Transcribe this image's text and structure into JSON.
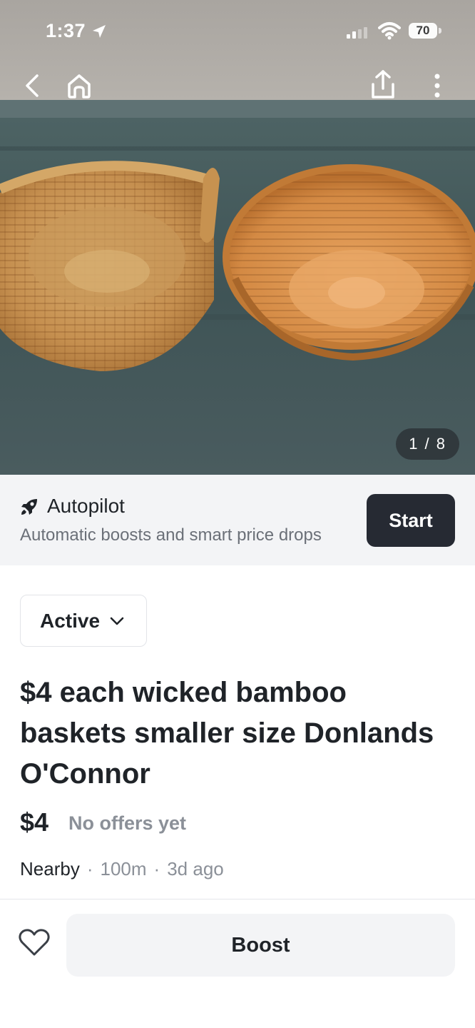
{
  "status_bar": {
    "time": "1:37",
    "battery": "70"
  },
  "photo": {
    "counter": "1 / 8"
  },
  "autopilot": {
    "title": "Autopilot",
    "subtitle": "Automatic boosts and smart price drops",
    "start_label": "Start"
  },
  "listing": {
    "status": "Active",
    "title": "$4 each wicked bamboo baskets smaller size Donlands O'Connor",
    "price": "$4",
    "offers": "No offers yet",
    "location": "Nearby",
    "distance": "100m",
    "posted": "3d ago"
  },
  "actions": {
    "boost_label": "Boost"
  },
  "colors": {
    "accent_dark": "#262a33",
    "muted_text": "#8b9098",
    "banner_bg": "#f3f4f6"
  }
}
